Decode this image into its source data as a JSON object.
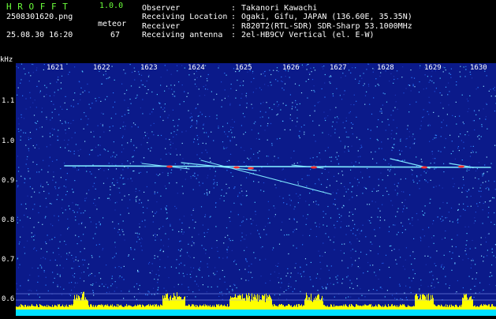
{
  "header": {
    "app_title": "H R O F F T",
    "app_version": "1.0.0",
    "file_name": "2508301620.png",
    "mode": "meteor",
    "datetime": "25.08.30 16:20",
    "count": "67"
  },
  "info": [
    {
      "label": "Observer",
      "value": "Takanori Kawachi"
    },
    {
      "label": "Receiving Location",
      "value": "Ogaki, Gifu, JAPAN (136.60E, 35.35N)"
    },
    {
      "label": "Receiver",
      "value": "R820T2(RTL-SDR) SDR-Sharp 53.1000MHz"
    },
    {
      "label": "Receiving antenna",
      "value": "2el-HB9CV Vertical (el. E-W)"
    }
  ],
  "axis": {
    "y_unit": "kHz",
    "y_ticks": [
      "1.1",
      "1.0",
      "0.9",
      "0.8",
      "0.7",
      "0.6"
    ],
    "x_ticks": [
      "1621",
      "1622",
      "1623",
      "1624",
      "1625",
      "1626",
      "1627",
      "1628",
      "1629",
      "1630"
    ]
  },
  "colors": {
    "background": "#000000",
    "spectrogram_bg": "#0b1a8a",
    "signal": "#7fe8ff",
    "hot": "#ff3030",
    "level_bar": "#ffff00",
    "baseline": "#00e0ff",
    "title": "#6bff3b"
  }
}
